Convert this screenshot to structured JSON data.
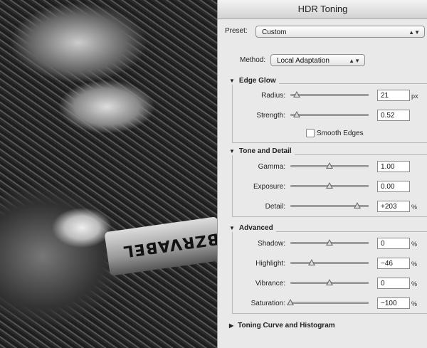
{
  "dialog": {
    "title": "HDR Toning"
  },
  "preset": {
    "label": "Preset:",
    "value": "Custom"
  },
  "method": {
    "label": "Method:",
    "value": "Local Adaptation"
  },
  "photo": {
    "glove_text": "OBZRVABEL"
  },
  "edge_glow": {
    "title": "Edge Glow",
    "radius": {
      "label": "Radius:",
      "value": "21",
      "unit": "px",
      "fraction": 0.08
    },
    "strength": {
      "label": "Strength:",
      "value": "0.52",
      "unit": "",
      "fraction": 0.08
    },
    "smooth_edges": {
      "label": "Smooth Edges",
      "checked": false
    }
  },
  "tone_detail": {
    "title": "Tone and Detail",
    "gamma": {
      "label": "Gamma:",
      "value": "1.00",
      "unit": "",
      "fraction": 0.5
    },
    "exposure": {
      "label": "Exposure:",
      "value": "0.00",
      "unit": "",
      "fraction": 0.5
    },
    "detail": {
      "label": "Detail:",
      "value": "+203",
      "unit": "%",
      "fraction": 0.85
    }
  },
  "advanced": {
    "title": "Advanced",
    "shadow": {
      "label": "Shadow:",
      "value": "0",
      "unit": "%",
      "fraction": 0.5
    },
    "highlight": {
      "label": "Highlight:",
      "value": "−46",
      "unit": "%",
      "fraction": 0.27
    },
    "vibrance": {
      "label": "Vibrance:",
      "value": "0",
      "unit": "%",
      "fraction": 0.5
    },
    "saturation": {
      "label": "Saturation:",
      "value": "−100",
      "unit": "%",
      "fraction": 0.0
    }
  },
  "toning_curve": {
    "title": "Toning Curve and Histogram"
  }
}
